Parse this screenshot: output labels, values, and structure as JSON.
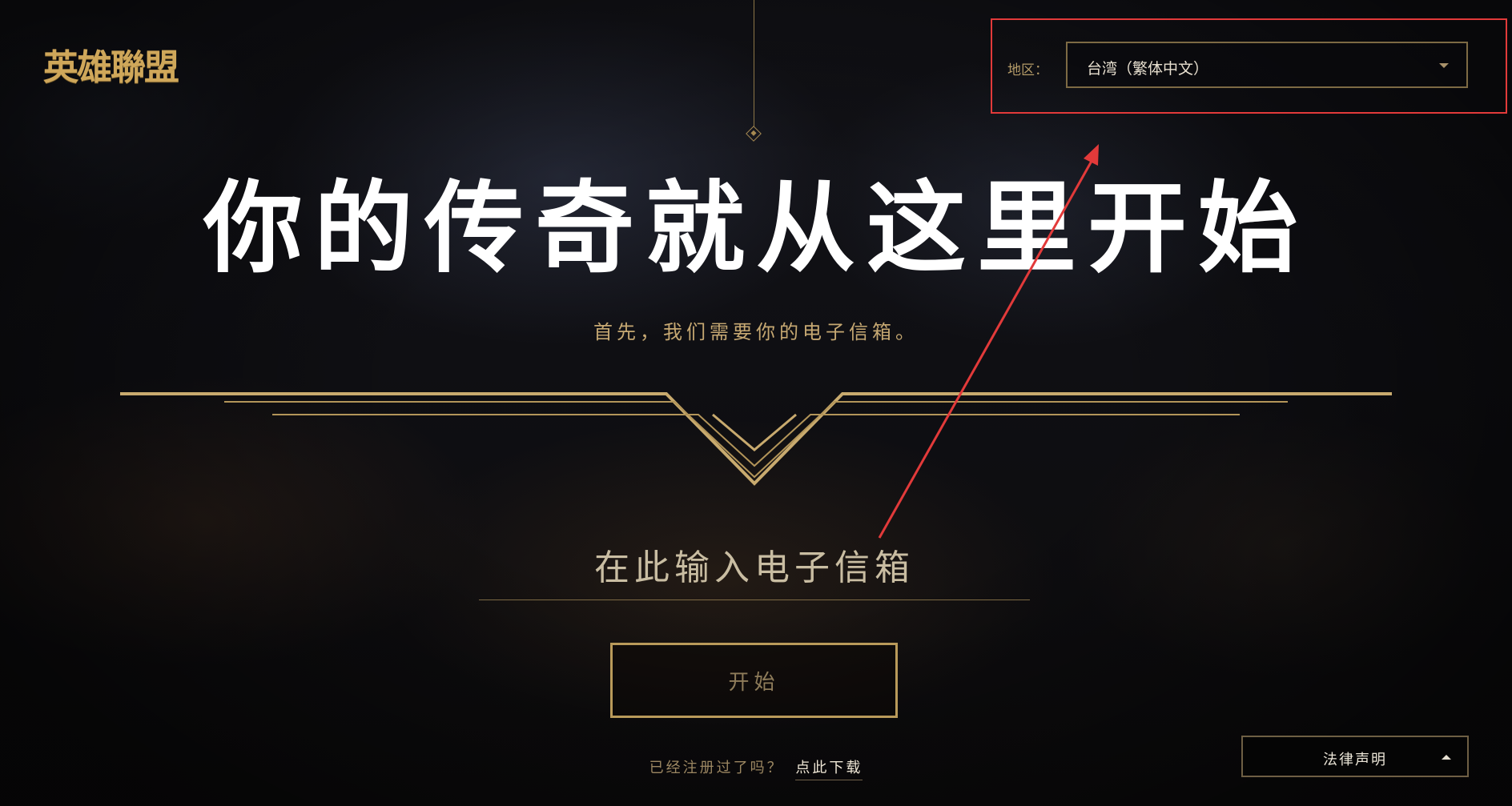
{
  "brand": {
    "logo_text": "英雄聯盟"
  },
  "region": {
    "label": "地区：",
    "selected": "台湾（繁体中文）",
    "caret_icon": "chevron-down-icon"
  },
  "hero": {
    "headline": "你的传奇就从这里开始",
    "subline": "首先，我们需要你的电子信箱。"
  },
  "form": {
    "email_placeholder": "在此输入电子信箱",
    "start_label": "开始"
  },
  "footer": {
    "registered_question": "已经注册过了吗？",
    "download_link": "点此下载",
    "legal_label": "法律声明",
    "legal_icon": "chevron-up-icon"
  },
  "colors": {
    "gold": "#c8aa6e",
    "annotation": "#e23a3a",
    "background": "#0b0b0d"
  }
}
